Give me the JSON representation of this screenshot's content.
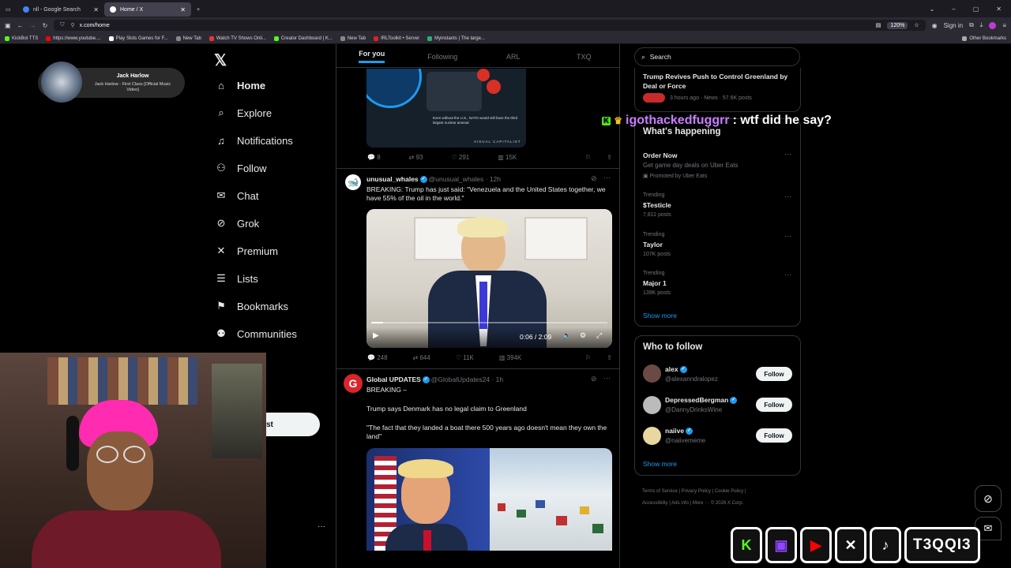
{
  "browser": {
    "tabs": [
      {
        "title": "nll - Google Search",
        "color": "#4285f4"
      },
      {
        "title": "Home / X",
        "color": "#ffffff"
      }
    ],
    "url": "x.com/home",
    "zoom": "120%",
    "sign_in": "Sign in",
    "bookmarks": [
      "KickBot TTS",
      "https://www.youtube....",
      "Play Slots Games for F...",
      "New Tab",
      "Watch TV Shows Onli...",
      "Creator Dashboard | K...",
      "New Tab",
      "IRLToolkit • Server",
      "Myinstants | The large..."
    ],
    "other_bookmarks": "Other Bookmarks"
  },
  "nav": {
    "items": [
      {
        "label": "Home",
        "icon": "home-icon",
        "glyph": "⌂"
      },
      {
        "label": "Explore",
        "icon": "search-icon",
        "glyph": "⌕"
      },
      {
        "label": "Notifications",
        "icon": "bell-icon",
        "glyph": "🔔"
      },
      {
        "label": "Follow",
        "icon": "follow-icon",
        "glyph": "👤"
      },
      {
        "label": "Chat",
        "icon": "mail-icon",
        "glyph": "✉"
      },
      {
        "label": "Grok",
        "icon": "grok-icon",
        "glyph": "⊘"
      },
      {
        "label": "Premium",
        "icon": "x-icon",
        "glyph": "𝕏"
      },
      {
        "label": "Lists",
        "icon": "list-icon",
        "glyph": "☰"
      },
      {
        "label": "Bookmarks",
        "icon": "bookmark-icon",
        "glyph": "🔖"
      },
      {
        "label": "Communities",
        "icon": "communities-icon",
        "glyph": "👥"
      }
    ],
    "post_button_partial": "st"
  },
  "feed": {
    "tabs": [
      "For you",
      "Following",
      "ARL",
      "TXQ"
    ],
    "tweet0": {
      "infographic_text": "Even without the U.S., NATO would still have the third largest nuclear arsenal",
      "brand": "VISUAL CAPITALIST",
      "replies": "8",
      "reposts": "93",
      "likes": "291",
      "views": "15K"
    },
    "tweet1": {
      "name": "unusual_whales",
      "handle": "@unusual_whales · 12h",
      "text": "BREAKING: Trump has just said: \"Venezuela and the United States together, we have 55% of the oil in the world.\"",
      "video_time": "0:06 / 2:09",
      "video_progress": 0.05,
      "replies": "248",
      "reposts": "644",
      "likes": "11K",
      "views": "394K"
    },
    "tweet2": {
      "name": "Global UPDATES",
      "handle": "@GlobalUpdates24 · 1h",
      "line1": "BREAKING –",
      "line2": "Trump says Denmark has no legal claim to Greenland",
      "line3": "\"The fact that they landed a boat there 500 years ago doesn't mean they own the land\""
    }
  },
  "right": {
    "search_placeholder": "Search",
    "top_news": {
      "title": "Trump Revives Push to Control Greenland by Deal or Force",
      "meta": "3 hours ago · News · 57.6K posts"
    },
    "whats_happening": "What's happening",
    "ad": {
      "title": "Order Now",
      "desc": "Get game day deals on Uber Eats",
      "promo": "Promoted by Uber Eats"
    },
    "trends": [
      {
        "label": "Trending",
        "title": "$Testicle",
        "posts": "7,811 posts"
      },
      {
        "label": "Trending",
        "title": "Taylor",
        "posts": "107K posts"
      },
      {
        "label": "Trending",
        "title": "Major 1",
        "posts": "139K posts"
      }
    ],
    "show_more": "Show more",
    "who_to_follow": "Who to follow",
    "follow_suggestions": [
      {
        "name": "alex",
        "handle": "@alexanndralopez"
      },
      {
        "name": "DepressedBergman",
        "handle": "@DannyDrinksWine"
      },
      {
        "name": "naiive",
        "handle": "@naiivememe"
      }
    ],
    "follow_label": "Follow",
    "footer": [
      "Terms of Service",
      "Privacy Policy",
      "Cookie Policy",
      "Accessibility",
      "Ads info",
      "More ···",
      "© 2026 X Corp."
    ]
  },
  "overlay": {
    "spotify": {
      "artist": "Jack Harlow",
      "track": "Jack Harlow - First Class [Official Music Video]"
    },
    "chat": {
      "user": "igothackedfuggrr",
      "message": ": wtf did he say?",
      "user_color": "#c77dff"
    },
    "streamer_tag": "T3QQI3",
    "kick_color": "#53fc18",
    "twitch_color": "#9146ff",
    "youtube_color": "#ff0000"
  }
}
